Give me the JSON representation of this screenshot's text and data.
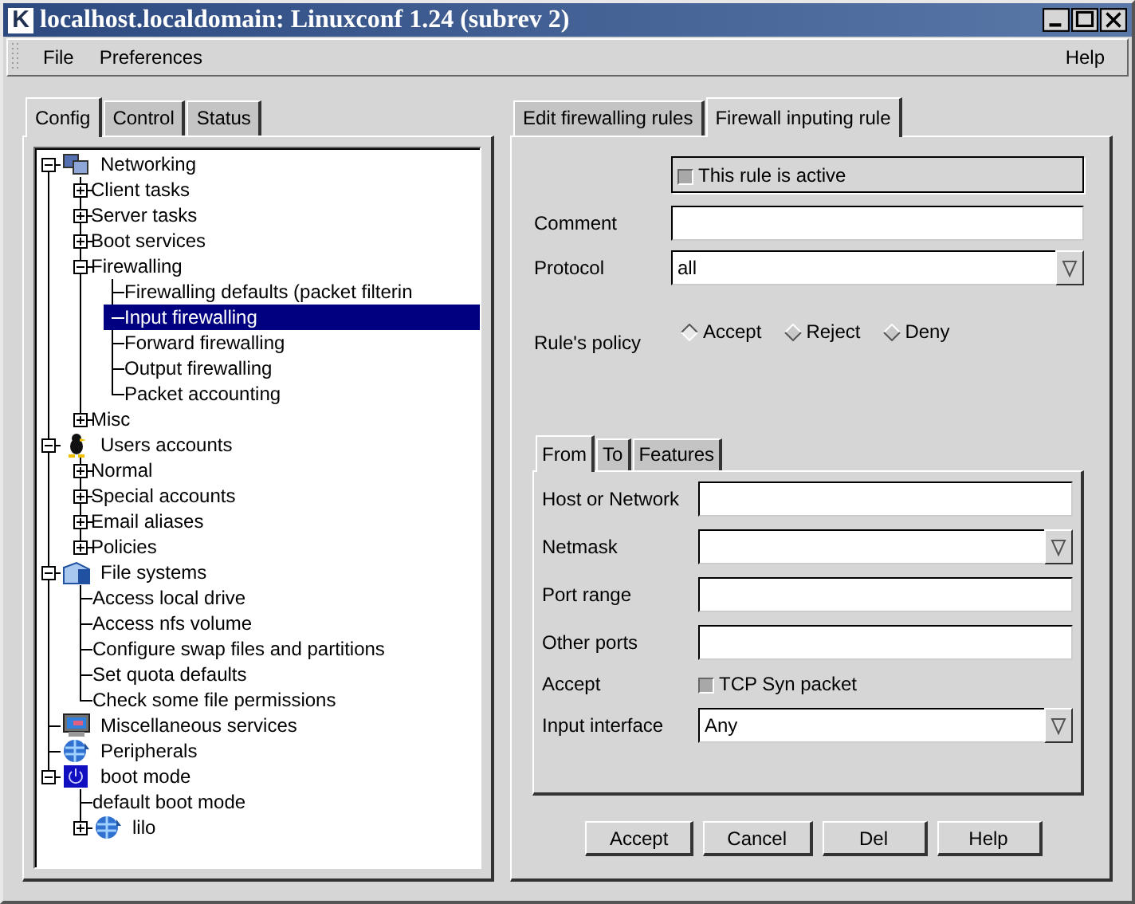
{
  "window": {
    "logo": "K",
    "title": "localhost.localdomain: Linuxconf 1.24 (subrev 2)"
  },
  "menu": [
    {
      "label": "File"
    },
    {
      "label": "Preferences"
    },
    {
      "label": "Help"
    }
  ],
  "left_tabs": [
    {
      "label": "Config",
      "selected": true
    },
    {
      "label": "Control",
      "selected": false
    },
    {
      "label": "Status",
      "selected": false
    }
  ],
  "tree": [
    {
      "label": "Networking",
      "expanded": true,
      "selected": false,
      "children": [
        {
          "label": "Client tasks",
          "expanded": false,
          "selected": false
        },
        {
          "label": "Server tasks",
          "expanded": false,
          "selected": false
        },
        {
          "label": "Boot services",
          "expanded": false,
          "selected": false
        },
        {
          "label": "Firewalling",
          "expanded": true,
          "selected": false,
          "children": [
            {
              "label": "Firewalling defaults (packet filterin",
              "selected": false
            },
            {
              "label": "Input firewalling",
              "selected": true
            },
            {
              "label": "Forward firewalling",
              "selected": false
            },
            {
              "label": "Output firewalling",
              "selected": false
            },
            {
              "label": "Packet accounting",
              "selected": false
            }
          ]
        },
        {
          "label": "Misc",
          "expanded": false,
          "selected": false
        }
      ]
    },
    {
      "label": "Users accounts",
      "expanded": true,
      "selected": false,
      "children": [
        {
          "label": "Normal",
          "expanded": false,
          "selected": false
        },
        {
          "label": "Special accounts",
          "expanded": false,
          "selected": false
        },
        {
          "label": "Email aliases",
          "expanded": false,
          "selected": false
        },
        {
          "label": "Policies",
          "expanded": false,
          "selected": false
        }
      ]
    },
    {
      "label": "File systems",
      "expanded": true,
      "selected": false,
      "children": [
        {
          "label": "Access local drive",
          "selected": false
        },
        {
          "label": "Access nfs volume",
          "selected": false
        },
        {
          "label": "Configure swap files and partitions",
          "selected": false
        },
        {
          "label": "Set quota defaults",
          "selected": false
        },
        {
          "label": "Check some file permissions",
          "selected": false
        }
      ]
    },
    {
      "label": "Miscellaneous services",
      "selected": false
    },
    {
      "label": "Peripherals",
      "selected": false
    },
    {
      "label": "boot mode",
      "expanded": true,
      "selected": false,
      "children": [
        {
          "label": "default boot mode",
          "selected": false
        },
        {
          "label": "lilo",
          "expanded": false,
          "selected": false
        }
      ]
    }
  ],
  "right_tabs": [
    {
      "label": "Edit firewalling rules",
      "selected": false
    },
    {
      "label": "Firewall inputing rule",
      "selected": true
    }
  ],
  "rule": {
    "active": {
      "label": "This rule is active",
      "checked": false
    },
    "comment": {
      "label": "Comment"
    },
    "protocol": {
      "label": "Protocol",
      "value": "all"
    },
    "policy": {
      "label": "Rule's policy",
      "options": [
        {
          "label": "Accept",
          "selected": true
        },
        {
          "label": "Reject",
          "selected": false
        },
        {
          "label": "Deny",
          "selected": false
        }
      ]
    }
  },
  "sub_tabs": [
    {
      "label": "From",
      "selected": true
    },
    {
      "label": "To",
      "selected": false
    },
    {
      "label": "Features",
      "selected": false
    }
  ],
  "from_fields": [
    {
      "kind": "text",
      "label": "Host or Network"
    },
    {
      "kind": "combo",
      "label": "Netmask"
    },
    {
      "kind": "text",
      "label": "Port range"
    },
    {
      "kind": "text",
      "label": "Other ports"
    },
    {
      "kind": "check",
      "label": "Accept",
      "option": "TCP Syn packet",
      "checked": false
    },
    {
      "kind": "combo",
      "label": "Input interface",
      "value": "Any"
    }
  ],
  "buttons": [
    {
      "label": "Accept"
    },
    {
      "label": "Cancel"
    },
    {
      "label": "Del"
    },
    {
      "label": "Help"
    }
  ]
}
